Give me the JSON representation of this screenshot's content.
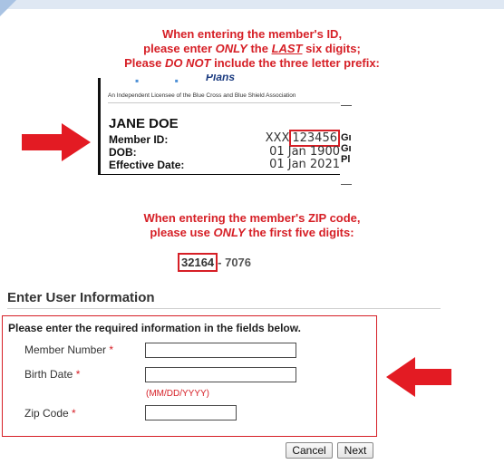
{
  "instructions_id": {
    "line1": "When entering the member's ID,",
    "line2_a": "please enter ",
    "line2_em": "ONLY",
    "line2_b": " the ",
    "line2_u": "LAST",
    "line2_c": " six digits;",
    "line3_a": "Please ",
    "line3_em": "DO NOT",
    "line3_b": " include the three letter prefix:"
  },
  "card": {
    "brand_word": "Plans",
    "licensee": "An Independent Licensee of the Blue Cross and Blue Shield Association",
    "name": "JANE DOE",
    "member_id_label": "Member ID:",
    "member_id_prefix": "XXX",
    "member_id_digits": "123456",
    "dob_label": "DOB:",
    "dob_value": "01 Jan 1900",
    "effective_label": "Effective Date:",
    "effective_value": "01 Jan 2021",
    "side_1": "Gı",
    "side_2": "Gı",
    "side_3": "Pl"
  },
  "instructions_zip": {
    "line1": "When entering the member's ZIP code,",
    "line2_a": "please use ",
    "line2_em": "ONLY",
    "line2_b": " the first five digits:"
  },
  "zip_example": {
    "first5": "32164",
    "rest": "- 7076"
  },
  "form": {
    "section_title": "Enter User Information",
    "intro": "Please enter the required information in the fields below.",
    "member_number_label": "Member Number",
    "birth_date_label": "Birth Date",
    "birth_date_hint": "(MM/DD/YYYY)",
    "zip_code_label": "Zip Code",
    "required_mark": "*",
    "member_number_value": "",
    "birth_date_value": "",
    "zip_code_value": ""
  },
  "buttons": {
    "cancel": "Cancel",
    "next": "Next"
  },
  "colors": {
    "accent_red": "#d61f26"
  }
}
